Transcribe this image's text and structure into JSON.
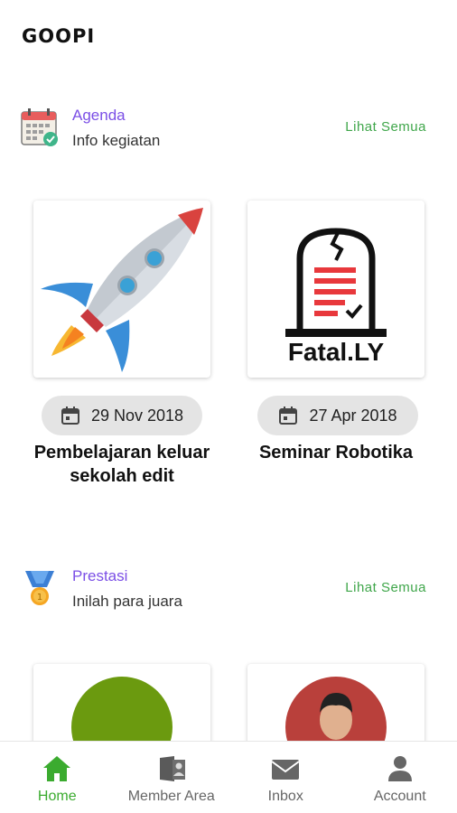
{
  "app": {
    "title": "GOOPI"
  },
  "agenda": {
    "title": "Agenda",
    "subtitle": "Info kegiatan",
    "see_all": "Lihat Semua",
    "items": [
      {
        "date": "29 Nov 2018",
        "title": "Pembelajaran keluar sekolah edit",
        "image": "rocket-illustration"
      },
      {
        "date": "27 Apr 2018",
        "title": "Seminar Robotika",
        "image": "fatal-ly-logo",
        "logo_text": "Fatal.LY"
      }
    ]
  },
  "prestasi": {
    "title": "Prestasi",
    "subtitle": "Inilah para juara",
    "see_all": "Lihat Semua"
  },
  "nav": {
    "items": [
      {
        "label": "Home",
        "icon": "home-icon",
        "active": true
      },
      {
        "label": "Member Area",
        "icon": "member-area-icon",
        "active": false
      },
      {
        "label": "Inbox",
        "icon": "mail-icon",
        "active": false
      },
      {
        "label": "Account",
        "icon": "account-icon",
        "active": false
      }
    ]
  },
  "colors": {
    "accent_purple": "#7b4fe6",
    "accent_green": "#3fa64a",
    "nav_active": "#3bab2f"
  }
}
